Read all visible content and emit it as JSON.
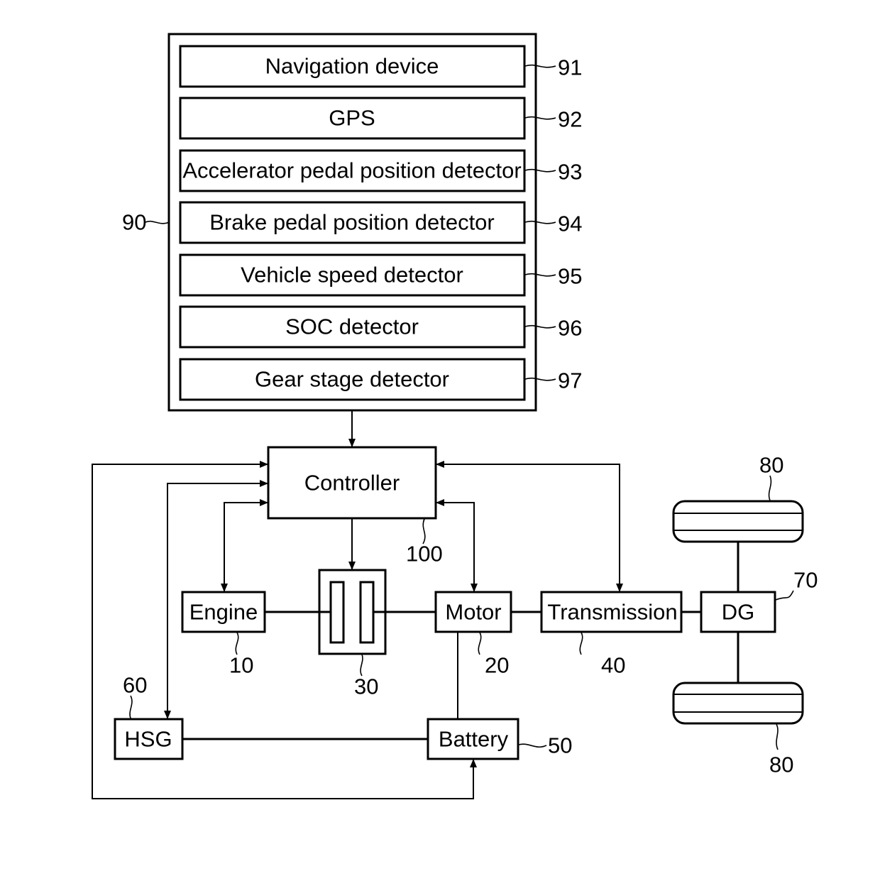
{
  "diagram": {
    "colors": {
      "stroke": "#000000",
      "background": "#ffffff"
    },
    "sensor_group": {
      "ref": "90",
      "items": [
        {
          "label": "Navigation device",
          "ref": "91"
        },
        {
          "label": "GPS",
          "ref": "92"
        },
        {
          "label": "Accelerator pedal position detector",
          "ref": "93"
        },
        {
          "label": "Brake pedal position detector",
          "ref": "94"
        },
        {
          "label": "Vehicle speed detector",
          "ref": "95"
        },
        {
          "label": "SOC detector",
          "ref": "96"
        },
        {
          "label": "Gear stage detector",
          "ref": "97"
        }
      ]
    },
    "controller": {
      "label": "Controller",
      "ref": "100"
    },
    "engine": {
      "label": "Engine",
      "ref": "10"
    },
    "clutch": {
      "ref": "30"
    },
    "motor": {
      "label": "Motor",
      "ref": "20"
    },
    "transmission": {
      "label": "Transmission",
      "ref": "40"
    },
    "dg": {
      "label": "DG",
      "ref": "70"
    },
    "wheel_top": {
      "ref": "80"
    },
    "wheel_bottom": {
      "ref": "80"
    },
    "hsg": {
      "label": "HSG",
      "ref": "60"
    },
    "battery": {
      "label": "Battery",
      "ref": "50"
    },
    "connections": [
      {
        "from": "sensor_group",
        "to": "controller",
        "type": "arrow"
      },
      {
        "from": "controller",
        "to": "engine",
        "type": "bidirectional"
      },
      {
        "from": "controller",
        "to": "clutch",
        "type": "arrow"
      },
      {
        "from": "controller",
        "to": "motor",
        "type": "bidirectional"
      },
      {
        "from": "controller",
        "to": "transmission",
        "type": "bidirectional"
      },
      {
        "from": "controller",
        "to": "hsg",
        "type": "bidirectional"
      },
      {
        "from": "controller",
        "to": "battery",
        "type": "bidirectional"
      },
      {
        "from": "engine",
        "to": "clutch",
        "type": "shaft"
      },
      {
        "from": "clutch",
        "to": "motor",
        "type": "shaft"
      },
      {
        "from": "motor",
        "to": "transmission",
        "type": "shaft"
      },
      {
        "from": "transmission",
        "to": "dg",
        "type": "shaft"
      },
      {
        "from": "dg",
        "to": "wheel_top",
        "type": "shaft"
      },
      {
        "from": "dg",
        "to": "wheel_bottom",
        "type": "shaft"
      },
      {
        "from": "motor",
        "to": "battery",
        "type": "electric"
      },
      {
        "from": "hsg",
        "to": "battery",
        "type": "electric"
      }
    ]
  }
}
